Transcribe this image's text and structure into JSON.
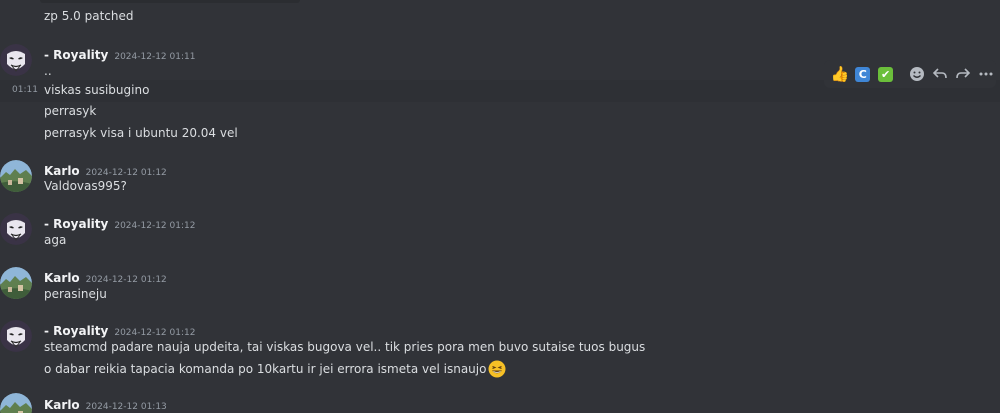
{
  "messages": [
    {
      "text": "zp 5.0 patched"
    },
    {
      "author": "- Royality",
      "time": "2024-12-12 01:11",
      "lines": [
        ".."
      ]
    },
    {
      "hover_time": "01:11",
      "lines": [
        "viskas susibugino",
        "perrasyk",
        "perrasyk visa i ubuntu 20.04 vel"
      ]
    },
    {
      "author": "Karlo",
      "time": "2024-12-12 01:12",
      "lines": [
        "Valdovas995?"
      ]
    },
    {
      "author": "- Royality",
      "time": "2024-12-12 01:12",
      "lines": [
        "aga"
      ]
    },
    {
      "author": "Karlo",
      "time": "2024-12-12 01:12",
      "lines": [
        "perasineju"
      ]
    },
    {
      "author": "- Royality",
      "time": "2024-12-12 01:12",
      "lines": [
        "steamcmd padare nauja updeita, tai viskas bugova vel.. tik pries pora men buvo sutaise tuos bugus",
        "o dabar reikia tapacia komanda po 10kartu ir jei errora ismeta vel isnaujo"
      ],
      "emoji": "grinning-squinting-face"
    },
    {
      "author": "Karlo",
      "time": "2024-12-12 01:13",
      "lines": []
    }
  ],
  "toolbar": {
    "reactions": [
      "thumbs-up",
      "letter-c",
      "check-mark"
    ],
    "c_label": "C",
    "check_label": "✔",
    "actions": [
      "add-reaction",
      "reply",
      "forward",
      "more"
    ]
  },
  "colors": {
    "background": "#313338",
    "text": "#dbdee1",
    "author": "#f2f3f5",
    "timestamp": "#949ba4"
  }
}
